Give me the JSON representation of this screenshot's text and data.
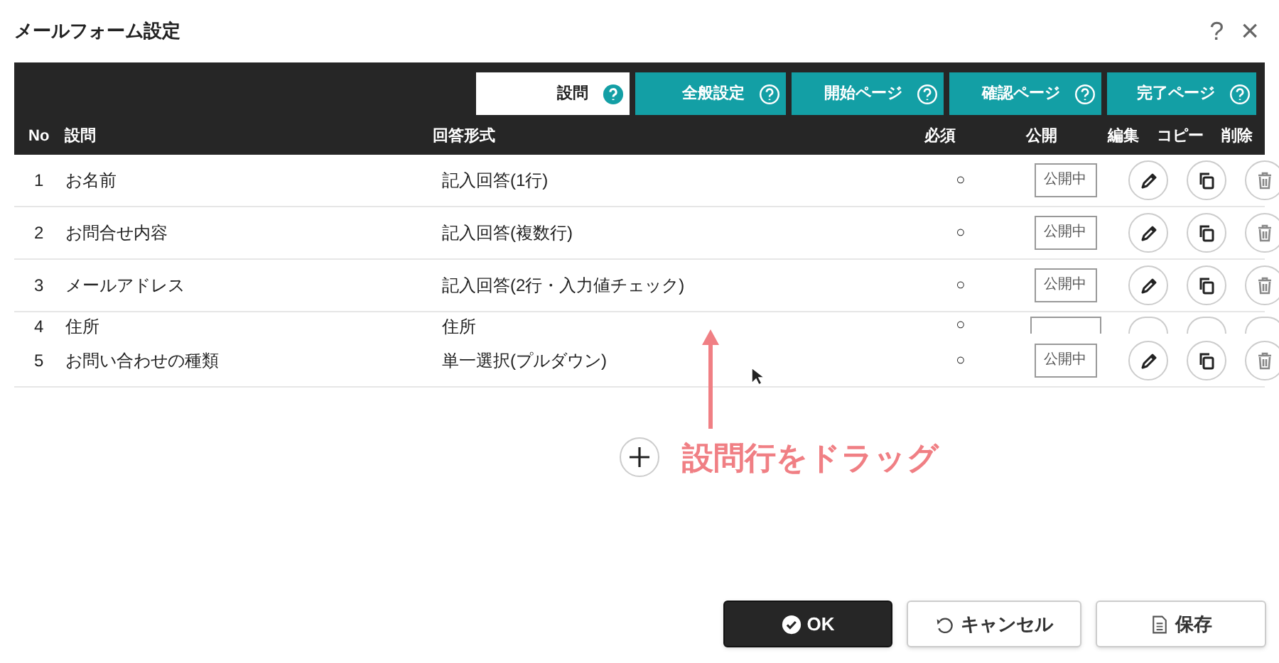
{
  "window": {
    "title": "メールフォーム設定",
    "help": "?",
    "close": "×"
  },
  "tabs": [
    {
      "label": "設問",
      "selected": true
    },
    {
      "label": "全般設定",
      "selected": false
    },
    {
      "label": "開始ページ",
      "selected": false
    },
    {
      "label": "確認ページ",
      "selected": false
    },
    {
      "label": "完了ページ",
      "selected": false
    }
  ],
  "columns": [
    "No",
    "設問",
    "回答形式",
    "必須",
    "公開",
    "編集",
    "コピー",
    "削除"
  ],
  "rows": [
    {
      "no": "1",
      "question": "お名前",
      "format": "記入回答(1行)",
      "required": "○",
      "status": "公開中",
      "partial": false
    },
    {
      "no": "2",
      "question": "お問合せ内容",
      "format": "記入回答(複数行)",
      "required": "○",
      "status": "公開中",
      "partial": false
    },
    {
      "no": "3",
      "question": "メールアドレス",
      "format": "記入回答(2行・入力値チェック)",
      "required": "○",
      "status": "公開中",
      "partial": false
    },
    {
      "no": "4",
      "question": "住所",
      "format": "住所",
      "required": "○",
      "partial": true
    },
    {
      "no": "5",
      "question": "お問い合わせの種類",
      "format": "単一選択(プルダウン)",
      "required": "○",
      "status": "公開中",
      "partial": false
    }
  ],
  "annotation": "設問行をドラッグ",
  "buttons": [
    {
      "label": "OK",
      "kind": "ok"
    },
    {
      "label": "キャンセル",
      "kind": "cancel"
    },
    {
      "label": "保存",
      "kind": "save"
    }
  ]
}
